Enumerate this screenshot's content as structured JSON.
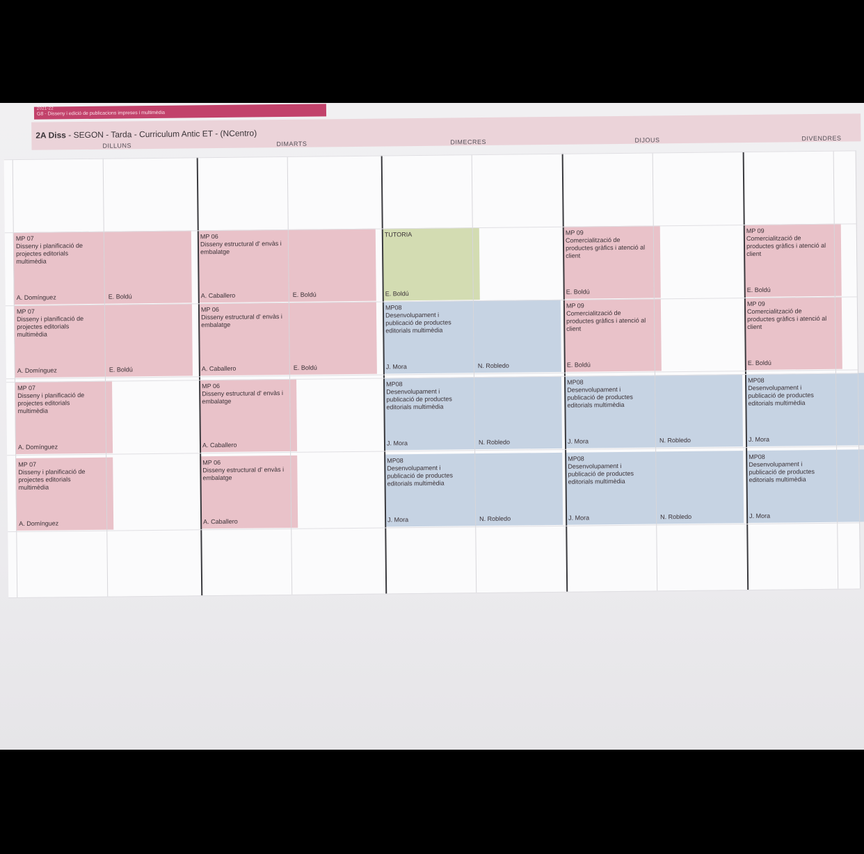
{
  "program": {
    "line1": "2021-22",
    "line2": "G8 - Disseny i edició de publicacions impreses i multimèdia"
  },
  "header": {
    "group": "2A Diss",
    "rest": " - SEGON - Tarda - Curriculum Antic ET - (NCentro)"
  },
  "days": [
    "DILLUNS",
    "DIMARTS",
    "DIMECRES",
    "DIJOUS",
    "DIVENDRES"
  ],
  "slots": [
    {
      "color": "pink",
      "code": "MP 07",
      "name": "Disseny i planificació de projectes editorials multimèdia",
      "t1": "A. Domínguez",
      "t2": "E. Boldú"
    },
    {
      "color": "pink",
      "code": "MP 06",
      "name": "Disseny estructural d' envàs i embalatge",
      "t1": "A. Caballero",
      "t2": "E. Boldú"
    },
    {
      "color": "green",
      "code": "",
      "name": "TUTORIA",
      "t1": "E. Boldú",
      "t2": ""
    },
    {
      "color": "pink",
      "code": "MP 09",
      "name": "Comercialització de productes gràfics i atenció al client",
      "t1": "E. Boldú",
      "t2": ""
    },
    {
      "color": "pink",
      "code": "MP 09",
      "name": "Comercialització de productes gràfics i atenció al client",
      "t1": "E. Boldú",
      "t2": ""
    },
    {
      "color": "pink",
      "code": "MP 07",
      "name": "Disseny i planificació de projectes editorials multimèdia",
      "t1": "A. Domínguez",
      "t2": "E. Boldú"
    },
    {
      "color": "pink",
      "code": "MP 06",
      "name": "Disseny estructural d' envàs i embalatge",
      "t1": "A. Caballero",
      "t2": "E. Boldú"
    },
    {
      "color": "blue",
      "code": "MP08",
      "name": "Desenvolupament i publicació de productes editorials multimèdia",
      "t1": "J. Mora",
      "t2": "N. Robledo"
    },
    {
      "color": "pink",
      "code": "MP 09",
      "name": "Comercialització de productes gràfics i atenció al client",
      "t1": "E. Boldú",
      "t2": ""
    },
    {
      "color": "pink",
      "code": "MP 09",
      "name": "Comercialització de productes gràfics i atenció al client",
      "t1": "E. Boldú",
      "t2": ""
    },
    {
      "color": "pink",
      "code": "MP 07",
      "name": "Disseny i planificació de projectes editorials multimèdia",
      "t1": "A. Domínguez",
      "t2": ""
    },
    {
      "color": "pink",
      "code": "MP 06",
      "name": "Disseny estructural d' envàs i embalatge",
      "t1": "A. Caballero",
      "t2": ""
    },
    {
      "color": "blue",
      "code": "MP08",
      "name": "Desenvolupament i publicació de productes editorials multimèdia",
      "t1": "J. Mora",
      "t2": "N. Robledo"
    },
    {
      "color": "blue",
      "code": "MP08",
      "name": "Desenvolupament i publicació de productes editorials multimèdia",
      "t1": "J. Mora",
      "t2": "N. Robledo"
    },
    {
      "color": "blue",
      "code": "MP08",
      "name": "Desenvolupament i publicació de productes editorials multimèdia",
      "t1": "J. Mora",
      "t2": ""
    },
    {
      "color": "pink",
      "code": "MP 07",
      "name": "Disseny i planificació de projectes editorials multimèdia",
      "t1": "A. Domínguez",
      "t2": ""
    },
    {
      "color": "pink",
      "code": "MP 06",
      "name": "Disseny estructural d' envàs i embalatge",
      "t1": "A. Caballero",
      "t2": ""
    },
    {
      "color": "blue",
      "code": "MP08",
      "name": "Desenvolupament i publicació de productes editorials multimèdia",
      "t1": "J. Mora",
      "t2": "N. Robledo"
    },
    {
      "color": "blue",
      "code": "MP08",
      "name": "Desenvolupament i publicació de productes editorials multimèdia",
      "t1": "J. Mora",
      "t2": "N. Robledo"
    },
    {
      "color": "blue",
      "code": "MP08",
      "name": "Desenvolupament i publicació de productes editorials multimèdia",
      "t1": "J. Mora",
      "t2": ""
    }
  ]
}
